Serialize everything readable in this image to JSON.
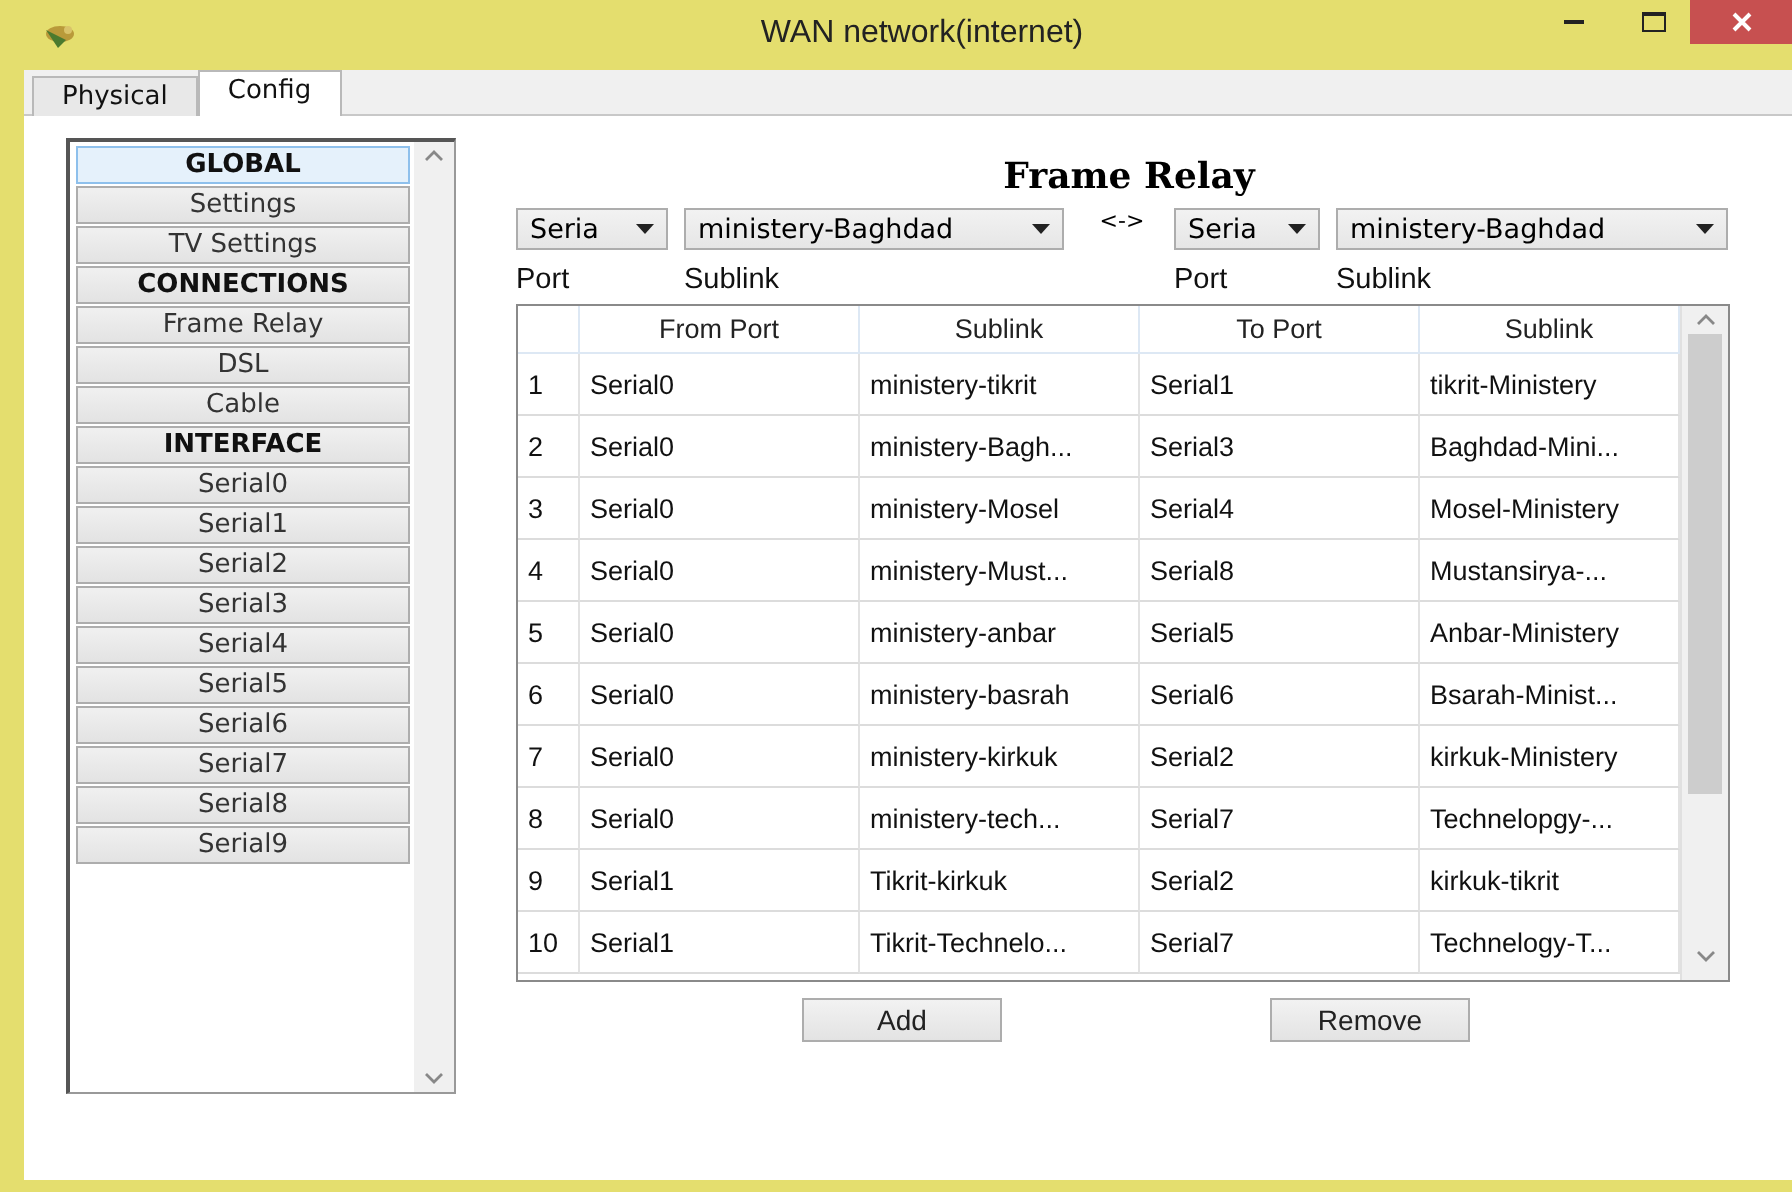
{
  "window": {
    "title": "WAN network(internet)"
  },
  "tabs": [
    {
      "label": "Physical",
      "selected": false
    },
    {
      "label": "Config",
      "selected": true
    }
  ],
  "sidebar": {
    "items": [
      {
        "label": "GLOBAL",
        "kind": "heading",
        "selected": true
      },
      {
        "label": "Settings",
        "kind": "item",
        "selected": false
      },
      {
        "label": "TV Settings",
        "kind": "item",
        "selected": false
      },
      {
        "label": "CONNECTIONS",
        "kind": "heading",
        "selected": false
      },
      {
        "label": "Frame Relay",
        "kind": "item",
        "selected": false
      },
      {
        "label": "DSL",
        "kind": "item",
        "selected": false
      },
      {
        "label": "Cable",
        "kind": "item",
        "selected": false
      },
      {
        "label": "INTERFACE",
        "kind": "heading",
        "selected": false
      },
      {
        "label": "Serial0",
        "kind": "item",
        "selected": false
      },
      {
        "label": "Serial1",
        "kind": "item",
        "selected": false
      },
      {
        "label": "Serial2",
        "kind": "item",
        "selected": false
      },
      {
        "label": "Serial3",
        "kind": "item",
        "selected": false
      },
      {
        "label": "Serial4",
        "kind": "item",
        "selected": false
      },
      {
        "label": "Serial5",
        "kind": "item",
        "selected": false
      },
      {
        "label": "Serial6",
        "kind": "item",
        "selected": false
      },
      {
        "label": "Serial7",
        "kind": "item",
        "selected": false
      },
      {
        "label": "Serial8",
        "kind": "item",
        "selected": false
      },
      {
        "label": "Serial9",
        "kind": "item",
        "selected": false
      }
    ]
  },
  "frame_relay": {
    "title": "Frame Relay",
    "from_port": {
      "value": "Seria"
    },
    "from_sublink": {
      "value": "ministery-Baghdad"
    },
    "separator": "<->",
    "to_port": {
      "value": "Seria"
    },
    "to_sublink": {
      "value": "ministery-Baghdad"
    },
    "labels": [
      "Port",
      "Sublink",
      "Port",
      "Sublink"
    ],
    "table": {
      "columns": [
        "From Port",
        "Sublink",
        "To Port",
        "Sublink"
      ],
      "rows": [
        {
          "number": "1",
          "cells": [
            "Serial0",
            "ministery-tikrit",
            "Serial1",
            "tikrit-Ministery"
          ]
        },
        {
          "number": "2",
          "cells": [
            "Serial0",
            "ministery-Bagh...",
            "Serial3",
            "Baghdad-Mini..."
          ]
        },
        {
          "number": "3",
          "cells": [
            "Serial0",
            "ministery-Mosel",
            "Serial4",
            "Mosel-Ministery"
          ]
        },
        {
          "number": "4",
          "cells": [
            "Serial0",
            "ministery-Must...",
            "Serial8",
            "Mustansirya-..."
          ]
        },
        {
          "number": "5",
          "cells": [
            "Serial0",
            "ministery-anbar",
            "Serial5",
            "Anbar-Ministery"
          ]
        },
        {
          "number": "6",
          "cells": [
            "Serial0",
            "ministery-basrah",
            "Serial6",
            "Bsarah-Minist..."
          ]
        },
        {
          "number": "7",
          "cells": [
            "Serial0",
            "ministery-kirkuk",
            "Serial2",
            "kirkuk-Ministery"
          ]
        },
        {
          "number": "8",
          "cells": [
            "Serial0",
            "ministery-tech...",
            "Serial7",
            "Technelopgy-..."
          ]
        },
        {
          "number": "9",
          "cells": [
            "Serial1",
            "Tikrit-kirkuk",
            "Serial2",
            "kirkuk-tikrit"
          ]
        },
        {
          "number": "10",
          "cells": [
            "Serial1",
            "Tikrit-Technelo...",
            "Serial7",
            "Technelogy-T..."
          ]
        }
      ]
    },
    "buttons": [
      "Add",
      "Remove"
    ]
  }
}
